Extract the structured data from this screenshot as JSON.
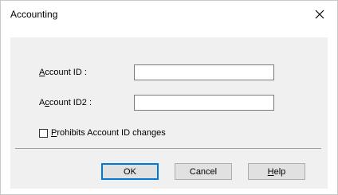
{
  "dialog": {
    "title": "Accounting",
    "close_glyph": "✕"
  },
  "fields": {
    "account_id": {
      "label_mnemonic": "A",
      "label_rest": "ccount ID :",
      "value": ""
    },
    "account_id2": {
      "label_before": "A",
      "label_mnemonic": "c",
      "label_rest": "count ID2 :",
      "value": ""
    }
  },
  "checkbox": {
    "label_mnemonic": "P",
    "label_rest": "rohibits Account ID changes",
    "checked": false
  },
  "buttons": {
    "ok": "OK",
    "cancel": "Cancel",
    "help_mnemonic": "H",
    "help_rest": "elp"
  }
}
